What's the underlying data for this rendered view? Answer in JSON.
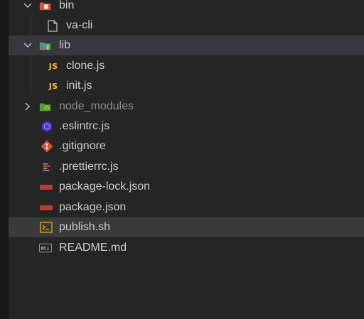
{
  "explorer": {
    "items": [
      {
        "label": "bin",
        "kind": "folder",
        "expanded": true,
        "icon": "bin-folder-icon"
      },
      {
        "label": "va-cli",
        "kind": "file",
        "icon": "file-icon"
      },
      {
        "label": "lib",
        "kind": "folder",
        "expanded": true,
        "icon": "lib-folder-icon"
      },
      {
        "label": "clone.js",
        "kind": "file",
        "icon": "js-file-icon",
        "icon_text": "JS"
      },
      {
        "label": "init.js",
        "kind": "file",
        "icon": "js-file-icon",
        "icon_text": "JS"
      },
      {
        "label": "node_modules",
        "kind": "folder",
        "expanded": false,
        "icon": "node-modules-folder-icon"
      },
      {
        "label": ".eslintrc.js",
        "kind": "file",
        "icon": "eslint-icon"
      },
      {
        "label": ".gitignore",
        "kind": "file",
        "icon": "git-icon"
      },
      {
        "label": ".prettierrc.js",
        "kind": "file",
        "icon": "prettier-icon"
      },
      {
        "label": "package-lock.json",
        "kind": "file",
        "icon": "npm-icon"
      },
      {
        "label": "package.json",
        "kind": "file",
        "icon": "npm-icon"
      },
      {
        "label": "publish.sh",
        "kind": "file",
        "icon": "terminal-icon"
      },
      {
        "label": "README.md",
        "kind": "file",
        "icon": "markdown-icon",
        "icon_text": "M↓"
      }
    ]
  },
  "colors": {
    "background": "#252526",
    "selected_row": "#37373d",
    "js_yellow": "#e8c13a",
    "npm_red": "#c0392b",
    "git_red": "#e0533a"
  }
}
